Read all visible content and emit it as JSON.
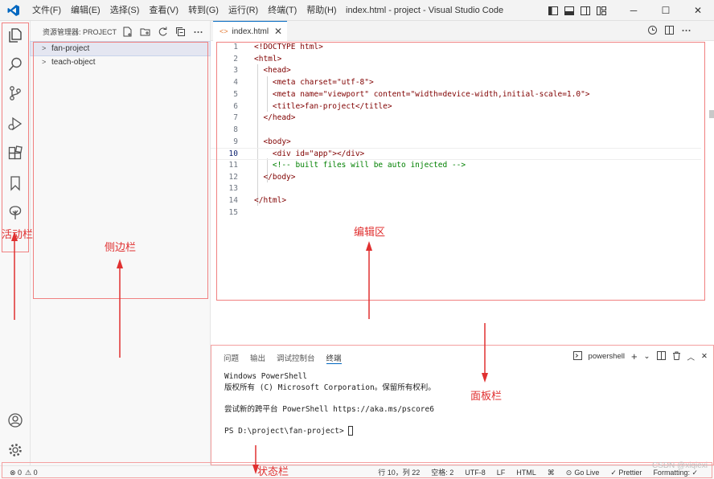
{
  "titlebar": {
    "menu": [
      "文件(F)",
      "编辑(E)",
      "选择(S)",
      "查看(V)",
      "转到(G)",
      "运行(R)",
      "终端(T)",
      "帮助(H)"
    ],
    "window_title": "index.html - project - Visual Studio Code",
    "window_buttons": {
      "minimize": "─",
      "maximize": "☐",
      "close": "✕"
    },
    "brand_color": "#0067c0"
  },
  "activitybar": {
    "icons": [
      "explorer-icon",
      "search-icon",
      "source-control-icon",
      "run-debug-icon",
      "extensions-icon",
      "bookmark-icon",
      "tree-icon",
      "account-icon",
      "settings-gear-icon"
    ]
  },
  "sidebar": {
    "header": "资源管理器: PROJECT",
    "items": [
      {
        "label": "fan-project",
        "selected": true
      },
      {
        "label": "teach-object",
        "selected": false
      }
    ]
  },
  "editor": {
    "tab": {
      "label": "index.html",
      "icon": "html-file-icon"
    },
    "lines": [
      {
        "n": "1",
        "code": "<!DOCTYPE html>"
      },
      {
        "n": "2",
        "code": "<html>"
      },
      {
        "n": "3",
        "code": "  <head>"
      },
      {
        "n": "4",
        "code": "    <meta charset=\"utf-8\">"
      },
      {
        "n": "5",
        "code": "    <meta name=\"viewport\" content=\"width=device-width,initial-scale=1.0\">"
      },
      {
        "n": "6",
        "code": "    <title>fan-project</title>"
      },
      {
        "n": "7",
        "code": "  </head>"
      },
      {
        "n": "8",
        "code": ""
      },
      {
        "n": "9",
        "code": "  <body>"
      },
      {
        "n": "10",
        "code": "    <div id=\"app\"></div>"
      },
      {
        "n": "11",
        "code": "    <!-- built files will be auto injected -->"
      },
      {
        "n": "12",
        "code": "  </body>"
      },
      {
        "n": "13",
        "code": ""
      },
      {
        "n": "14",
        "code": "</html>"
      },
      {
        "n": "15",
        "code": ""
      }
    ],
    "active_line": "10"
  },
  "panel": {
    "tabs": [
      "问题",
      "输出",
      "调试控制台",
      "终端"
    ],
    "active_tab": "终端",
    "shell": "powershell",
    "terminal_lines": [
      "Windows PowerShell",
      "版权所有 (C) Microsoft Corporation。保留所有权利。",
      "",
      "尝试新的跨平台 PowerShell https://aka.ms/pscore6",
      "",
      "PS D:\\project\\fan-project> "
    ]
  },
  "statusbar": {
    "errors": "⊗ 0",
    "warnings": "⚠ 0",
    "position": "行 10，列 22",
    "spaces": "空格: 2",
    "encoding": "UTF-8",
    "eol": "LF",
    "language": "HTML",
    "golive": "Go Live",
    "prettier": "✓ Prettier",
    "formatting": "Formatting: ✓"
  },
  "annotations": {
    "activity_bar": "活动栏",
    "sidebar": "侧边栏",
    "editor": "编辑区",
    "panel": "面板栏",
    "status_bar": "状态栏",
    "color": "#e03030"
  },
  "watermark": "CSDN @xiqiexi"
}
